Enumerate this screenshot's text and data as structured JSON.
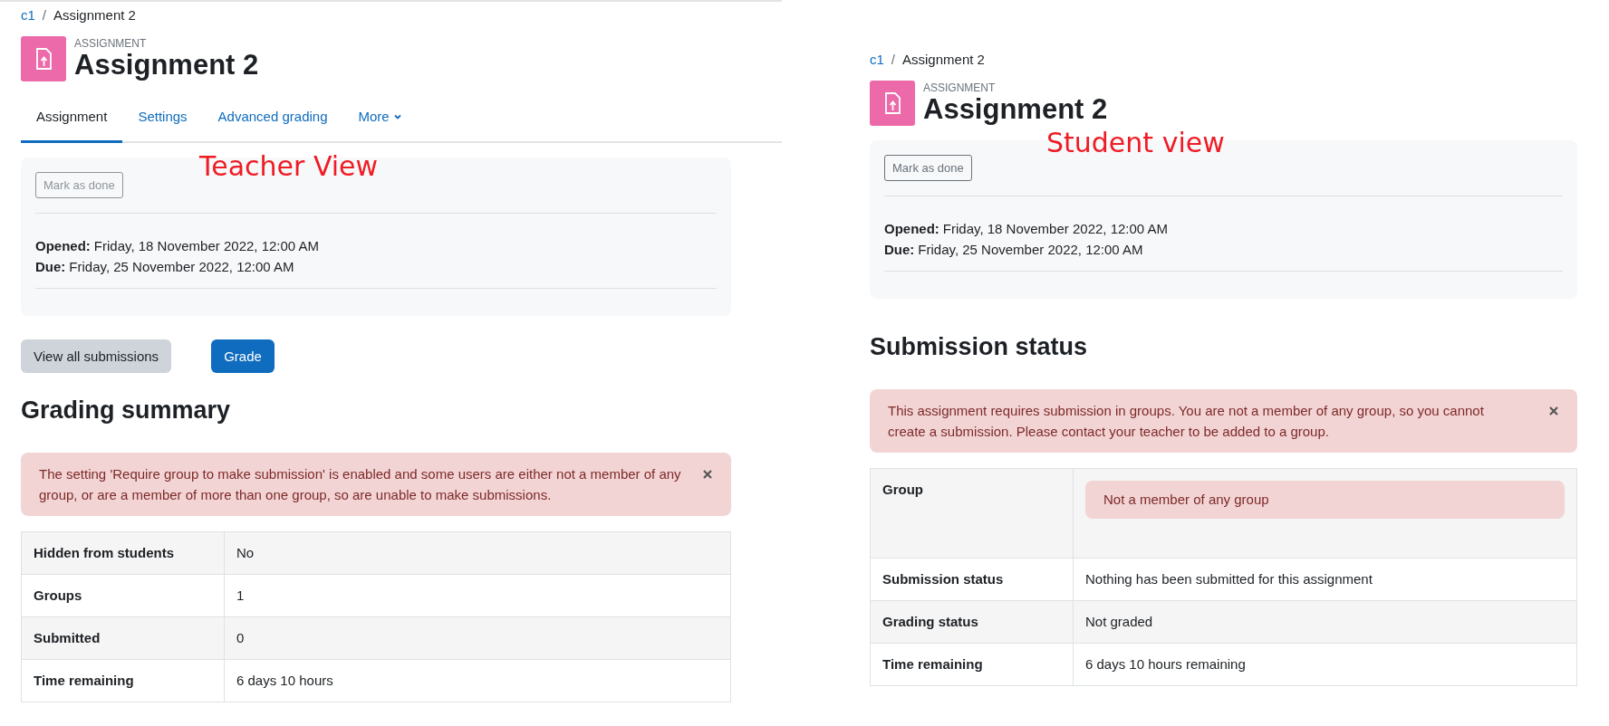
{
  "panels": [
    {
      "kind": "teacher",
      "annotation": "Teacher View",
      "separator": "/",
      "breadcrumb": [
        {
          "label": "c1",
          "link": true
        },
        {
          "label": "Assignment 2",
          "link": false
        }
      ],
      "module_type": "ASSIGNMENT",
      "title": "Assignment 2",
      "tabs": [
        {
          "label": "Assignment",
          "selected": true,
          "dropdown": false
        },
        {
          "label": "Settings",
          "selected": false,
          "dropdown": false
        },
        {
          "label": "Advanced grading",
          "selected": false,
          "dropdown": false
        },
        {
          "label": "More",
          "selected": false,
          "dropdown": true
        }
      ],
      "mark_done": "Mark as done",
      "dates": [
        {
          "label": "Opened:",
          "value": "Friday, 18 November 2022, 12:00 AM"
        },
        {
          "label": "Due:",
          "value": "Friday, 25 November 2022, 12:00 AM"
        }
      ],
      "buttons": [
        {
          "label": "View all submissions",
          "kind": "secondary"
        },
        {
          "label": "Grade",
          "kind": "primary"
        }
      ],
      "heading": "Grading summary",
      "alert": "The setting 'Require group to make submission' is enabled and some users are either not a member of any group, or are a member of more than one group, so are unable to make submissions.",
      "rows": [
        {
          "label": "Hidden from students",
          "value": "No",
          "kind": "text"
        },
        {
          "label": "Groups",
          "value": "1",
          "kind": "text"
        },
        {
          "label": "Submitted",
          "value": "0",
          "kind": "text"
        },
        {
          "label": "Time remaining",
          "value": "6 days 10 hours",
          "kind": "text"
        }
      ]
    },
    {
      "kind": "student",
      "annotation": "Student view",
      "separator": "/",
      "breadcrumb": [
        {
          "label": "c1",
          "link": true
        },
        {
          "label": "Assignment 2",
          "link": false
        }
      ],
      "module_type": "ASSIGNMENT",
      "title": "Assignment 2",
      "mark_done": "Mark as done",
      "dates": [
        {
          "label": "Opened:",
          "value": "Friday, 18 November 2022, 12:00 AM"
        },
        {
          "label": "Due:",
          "value": "Friday, 25 November 2022, 12:00 AM"
        }
      ],
      "heading": "Submission status",
      "alert": "This assignment requires submission in groups. You are not a member of any group, so you cannot create a submission. Please contact your teacher to be added to a group.",
      "rows": [
        {
          "label": "Group",
          "value": "Not a member of any group",
          "kind": "alert"
        },
        {
          "label": "Submission status",
          "value": "Nothing has been submitted for this assignment",
          "kind": "text"
        },
        {
          "label": "Grading status",
          "value": "Not graded",
          "kind": "text"
        },
        {
          "label": "Time remaining",
          "value": "6 days 10 hours remaining",
          "kind": "text"
        }
      ]
    }
  ]
}
